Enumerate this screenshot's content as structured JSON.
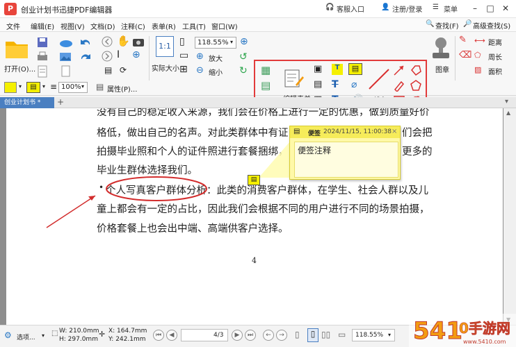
{
  "titlebar": {
    "logo": "P",
    "title": "创业计划书迅捷PDF编辑器",
    "service": "客服入口",
    "login": "注册/登录",
    "menu": "菜单"
  },
  "menubar": {
    "items": [
      "文件",
      "编辑(E)",
      "视图(V)",
      "文档(D)",
      "注释(C)",
      "表单(R)",
      "工具(T)",
      "窗口(W)"
    ],
    "find": "查找(F)",
    "adv_find": "高级查找(S)"
  },
  "ribbon": {
    "open": "打开(O)...",
    "actual_size": "实际大小",
    "zoom_value": "118.55%",
    "zoom_in": "放大",
    "zoom_out": "缩小",
    "edit_form": "编辑表单",
    "line": "线条",
    "stamp": "图章",
    "distance": "距离",
    "perimeter": "周长",
    "area": "面积",
    "stroke_width": "100%",
    "properties": "属性(P)..."
  },
  "tabs": {
    "doc_tab": "创业计划书 *"
  },
  "document": {
    "lines": [
      "没有自己的稳定收入来源，我们会在价格上进行一定的优惠，做到质量好价",
      "格低，做出自己的名声。对此类群体中有证",
      "拍摄毕业照和个人的证件照进行套餐捆绑，",
      "毕业生群体选择我们。",
      "个人写真客户群体分析：此类的消费客户群体，在学生、社会人群以及儿",
      "童上都会有一定的占比，因此我们会根据不同的用户进行不同的场景拍摄，",
      "价格套餐上也会出中端、高端供客户选择。"
    ],
    "line2_tail": "们会把",
    "line3_tail": "更多的",
    "bullet": "•",
    "page_number": "4"
  },
  "note": {
    "author": "便签",
    "date": "2024/11/15, 11:00:38",
    "close": "×",
    "text": "便签注释"
  },
  "statusbar": {
    "select": "选项...",
    "width": "W: 210.0mm",
    "height": "H: 297.0mm",
    "x": "X: 164.7mm",
    "y": "Y: 242.1mm",
    "page": "4/3",
    "zoom": "118.55%"
  },
  "watermark": {
    "text": "5410手游网",
    "url": "www.5410.com"
  },
  "colors": {
    "accent_red": "#e23b3b",
    "tab_blue": "#4a7fc1",
    "note_yellow": "#fff9a8",
    "highlight_yellow": "#f5f000",
    "brand_orange": "#f39c12"
  }
}
